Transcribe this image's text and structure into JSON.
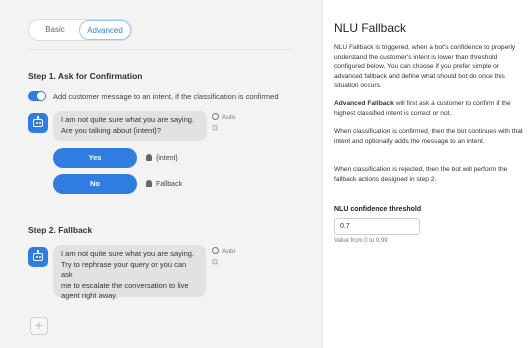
{
  "tabs": {
    "basic": "Basic",
    "advanced": "Advanced"
  },
  "step1": {
    "title": "Step 1. Ask for Confirmation",
    "toggle_label": "Add customer message to an intent, if the classification is confirmed",
    "bubble_line1": "I am not quite sure what you are saying.",
    "bubble_line2": "Are you talking about {intent}?",
    "auto": "Auto",
    "yes_label": "Yes",
    "yes_target": "{intent}",
    "no_label": "No",
    "no_target": "Fallback"
  },
  "step2": {
    "title": "Step 2. Fallback",
    "bubble_line1": "I am not quite sure what you are saying.",
    "bubble_line2": "Try to rephrase your query or you can ask",
    "bubble_line3": "me to escalate the conversation to live",
    "bubble_line4": "agent right away.",
    "auto": "Auto"
  },
  "add_symbol": "+",
  "panel": {
    "title": "NLU Fallback",
    "p1": "NLU Fallback is triggered, when a bot's confidence to properly understand the customer's intent is lower than threshold configured below. You can choose if you prefer simple or advanced fallback and define what should bot do once this situation occurs.",
    "p2_bold": "Advanced Fallback",
    "p2_rest": " will first ask a customer to confirm if the highest classified intent is correct or not.",
    "p3": "When classification is confirmed, then the bot continues with that intent and optionally adds the message to an intent.",
    "p4": "When classification is rejected, then the bot will perform the fallback actions designed in step 2.",
    "threshold_label": "NLU confidence threshold",
    "threshold_value": "0.7",
    "threshold_hint": "Value from 0 to 0.99"
  },
  "icons": {
    "bot": "bot-icon",
    "auto": "clock-icon",
    "card": "card-icon",
    "bulb": "lightbulb-icon",
    "add": "plus-icon"
  },
  "colors": {
    "accent": "#2f7de1",
    "left_bg": "#f3f3f3",
    "bubble": "#e2e2e2"
  }
}
